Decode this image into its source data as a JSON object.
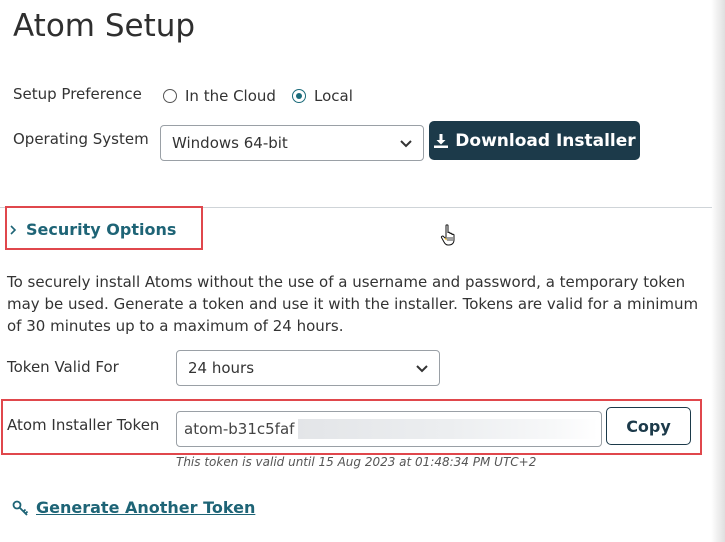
{
  "page": {
    "title": "Atom Setup"
  },
  "setup_preference": {
    "label": "Setup Preference",
    "options": [
      {
        "label": "In the Cloud",
        "checked": false
      },
      {
        "label": "Local",
        "checked": true
      }
    ]
  },
  "operating_system": {
    "label": "Operating System",
    "selected": "Windows 64-bit"
  },
  "download": {
    "label": "Download Installer",
    "icon": "download-icon"
  },
  "security": {
    "toggle_label": "Security Options",
    "description": "To securely install Atoms without the use of a username and password, a temporary token may be used. Generate a token and use it with the installer. Tokens are valid for a minimum of 30 minutes up to a maximum of 24 hours.",
    "token_valid_for": {
      "label": "Token Valid For",
      "selected": "24 hours"
    },
    "installer_token": {
      "label": "Atom Installer Token",
      "value": "atom-b31c5faf",
      "copy_label": "Copy",
      "validity_note": "This token is valid until 15 Aug 2023 at 01:48:34 PM UTC+2"
    },
    "generate_label": "Generate Another Token"
  },
  "colors": {
    "accent": "#1e6476",
    "button_dark": "#1c3a4a",
    "highlight": "#e0474c"
  }
}
